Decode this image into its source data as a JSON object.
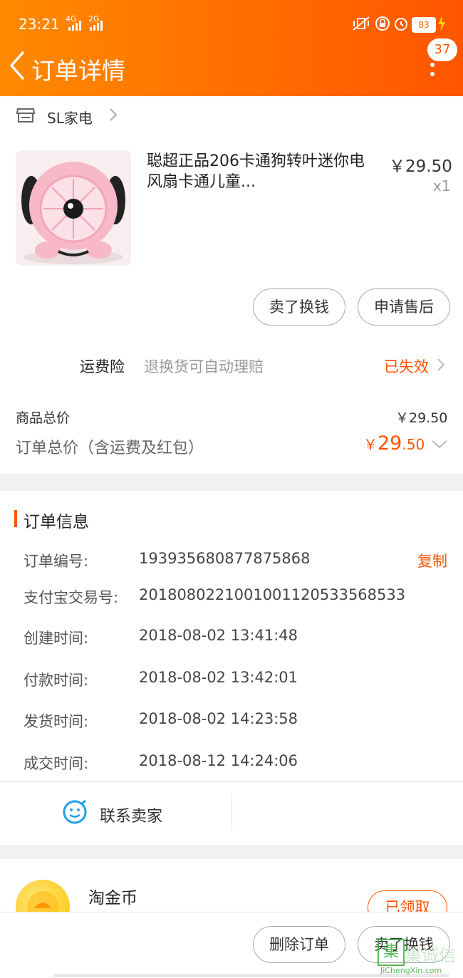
{
  "status_bar": {
    "time": "23:21",
    "network1": "4G",
    "network2": "2G",
    "battery": "83"
  },
  "header": {
    "title": "订单详情",
    "badge_count": "37"
  },
  "shop": {
    "name": "SL家电"
  },
  "product": {
    "title": "聪超正品206卡通狗转叶迷你电风扇卡通儿童...",
    "price": "￥29.50",
    "qty": "x1"
  },
  "product_actions": {
    "sell": "卖了换钱",
    "after_sale": "申请售后"
  },
  "insurance": {
    "label": "运费险",
    "desc": "退换货可自动理赔",
    "status": "已失效"
  },
  "totals": {
    "goods_label": "商品总价",
    "goods_value": "￥29.50",
    "order_label": "订单总价（含运费及红包）",
    "order_currency": "￥",
    "order_int": "29",
    "order_dec": ".50"
  },
  "order_info": {
    "heading": "订单信息",
    "copy": "复制",
    "rows": [
      {
        "label": "订单编号:",
        "value": "193935680877875868"
      },
      {
        "label": "支付宝交易号:",
        "value": "2018080221001001120533568533"
      },
      {
        "label": "创建时间:",
        "value": "2018-08-02 13:41:48"
      },
      {
        "label": "付款时间:",
        "value": "2018-08-02 13:42:01"
      },
      {
        "label": "发货时间:",
        "value": "2018-08-02 14:23:58"
      },
      {
        "label": "成交时间:",
        "value": "2018-08-12 14:24:06"
      }
    ]
  },
  "contact": {
    "label": "联系卖家"
  },
  "coins": {
    "label": "淘金币",
    "status": "已领取"
  },
  "bottom_bar": {
    "delete": "删除订单",
    "sell": "卖了换钱"
  },
  "watermark": {
    "main": "集诚信",
    "sub": "JiChengXin.com"
  },
  "colors": {
    "accent": "#ff5500",
    "header_start": "#ff8a00",
    "header_end": "#ff5500",
    "contact_icon": "#20a0e8"
  }
}
